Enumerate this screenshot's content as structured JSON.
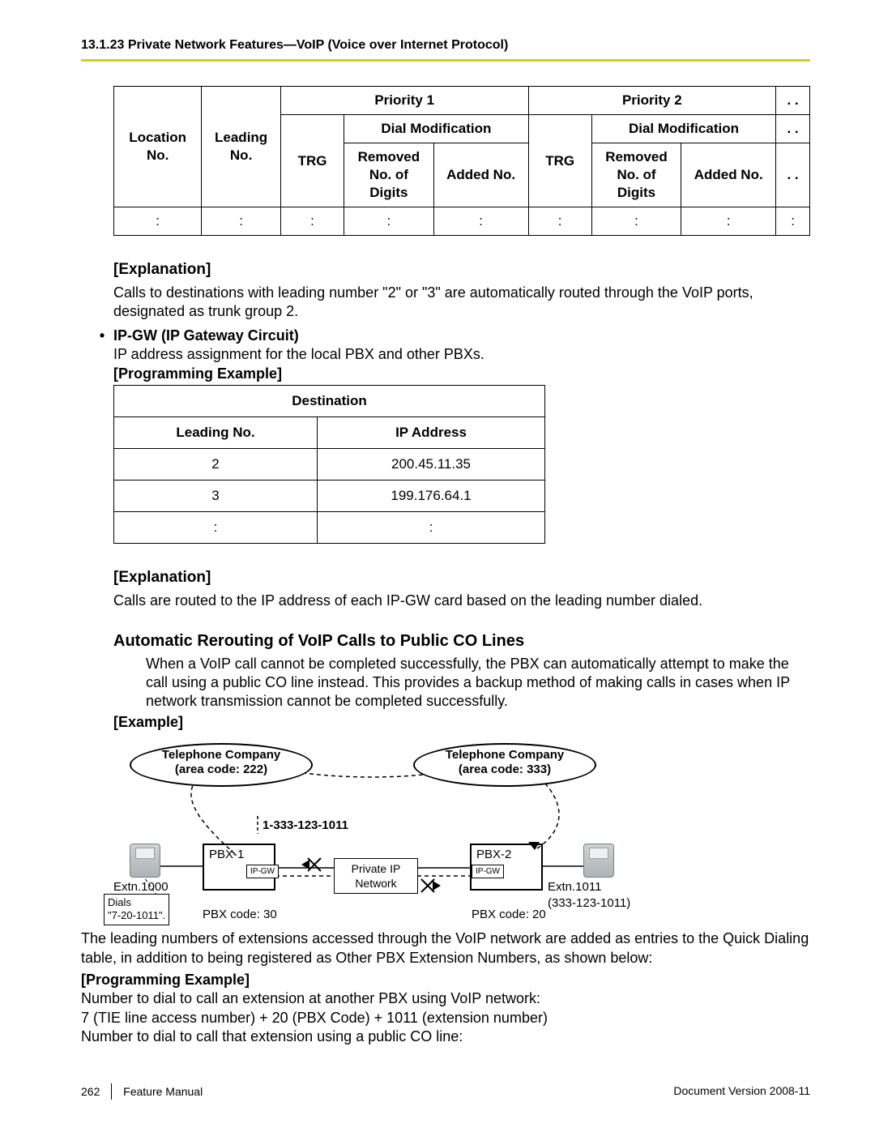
{
  "header": {
    "title": "13.1.23 Private Network Features—VoIP (Voice over Internet Protocol)"
  },
  "table1": {
    "h_location": "Location No.",
    "h_leading": "Leading No.",
    "h_p1": "Priority 1",
    "h_p2": "Priority 2",
    "h_dots": ". .",
    "h_dialmod": "Dial Modification",
    "h_trg": "TRG",
    "h_removed": "Removed No. of Digits",
    "h_added": "Added No.",
    "row_dots": ":"
  },
  "exp1_head": "[Explanation]",
  "exp1_text": "Calls to destinations with leading number \"2\" or \"3\" are automatically routed through the VoIP ports, designated as trunk group 2.",
  "ipgw_head": "IP-GW (IP Gateway Circuit)",
  "ipgw_text": "IP address assignment for the local PBX and other PBXs.",
  "prog_ex": "[Programming Example]",
  "table2": {
    "h_dest": "Destination",
    "h_lead": "Leading No.",
    "h_ip": "IP Address",
    "r1_lead": "2",
    "r1_ip": "200.45.11.35",
    "r2_lead": "3",
    "r2_ip": "199.176.64.1",
    "r3": ":"
  },
  "exp2_head": "[Explanation]",
  "exp2_text": "Calls are routed to the IP address of each IP-GW card based on the leading number dialed.",
  "auto_head": "Automatic Rerouting of VoIP Calls to Public CO Lines",
  "auto_text": "When a VoIP call cannot be completed successfully, the PBX can automatically attempt to make the call using a public CO line instead. This provides a backup method of making calls in cases when IP network transmission cannot be completed successfully.",
  "example_head": "[Example]",
  "diagram": {
    "telco1_l1": "Telephone Company",
    "telco1_l2": "(area code: 222)",
    "telco2_l1": "Telephone Company",
    "telco2_l2": "(area code: 333)",
    "dial_num": "1-333-123-1011",
    "pbx1": "PBX-1",
    "pbx2": "PBX-2",
    "ipgw": "IP-GW",
    "pin": "Private IP Network",
    "extn_left": "Extn.1000",
    "extn_right_l1": "Extn.1011",
    "extn_right_l2": "(333-123-1011)",
    "dials_l1": "Dials",
    "dials_l2": "\"7-20-1011\".",
    "code1": "PBX code: 30",
    "code2": "PBX code: 20"
  },
  "below1": "The leading numbers of extensions accessed through the VoIP network are added as entries to the Quick Dialing table, in addition to being registered as Other PBX Extension Numbers, as shown below:",
  "prog_ex2": "[Programming Example]",
  "below2": "Number to dial to call an extension at another PBX using VoIP network:",
  "below3": "7 (TIE line access number) + 20 (PBX Code) + 1011 (extension number)",
  "below4": "Number to dial to call that extension using a public CO line:",
  "footer": {
    "page": "262",
    "title": "Feature Manual",
    "ver": "Document Version  2008-11"
  }
}
